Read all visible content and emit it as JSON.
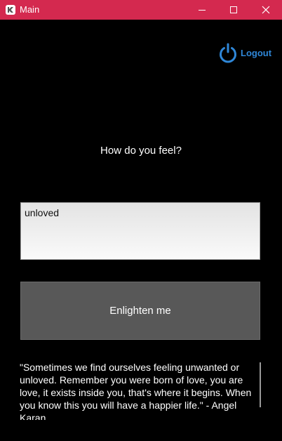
{
  "window": {
    "title": "Main",
    "app_icon": "kivy-logo-icon",
    "controls": {
      "minimize_icon": "minimize-icon",
      "maximize_icon": "maximize-icon",
      "close_icon": "close-icon"
    },
    "titlebar_color": "#d4294f"
  },
  "header": {
    "logout_label": "Logout",
    "logout_icon": "power-icon",
    "accent_color": "#2f87d8"
  },
  "main": {
    "prompt": "How do you feel?",
    "feeling_input": {
      "value": "unloved",
      "placeholder": ""
    },
    "enlighten_button_label": "Enlighten me",
    "quote": "\"Sometimes we find ourselves feeling unwanted or unloved. Remember you were born of love, you are love, it exists inside you, that's where it begins. When you know this you will have a happier life.\" - Angel Karan"
  }
}
